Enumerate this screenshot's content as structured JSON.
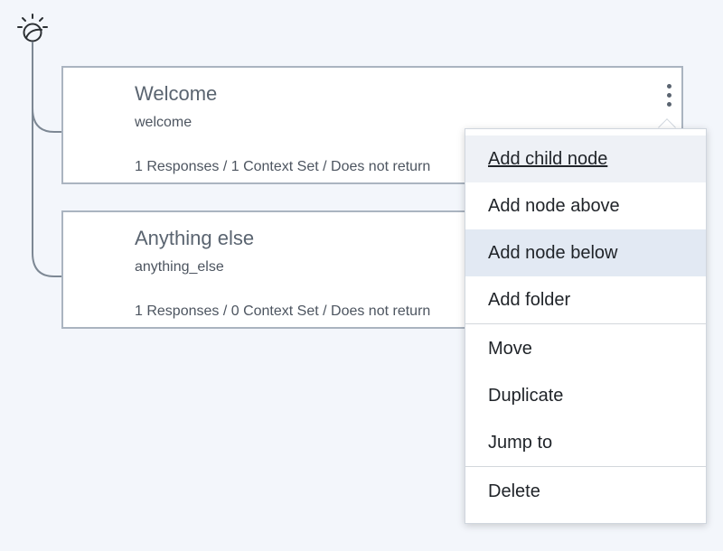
{
  "icons": {
    "tree_root": "bulb-icon",
    "overflow": "overflow-menu-icon"
  },
  "colors": {
    "background": "#f3f6fb",
    "card_border": "#aab4c0",
    "menu_hover": "#e2e9f3"
  },
  "nodes": [
    {
      "title": "Welcome",
      "condition": "welcome",
      "summary": "1 Responses / 1 Context Set / Does not return"
    },
    {
      "title": "Anything else",
      "condition": "anything_else",
      "summary": "1 Responses / 0 Context Set / Does not return"
    }
  ],
  "context_menu": {
    "groups": [
      [
        "Add child node",
        "Add node above",
        "Add node below",
        "Add folder"
      ],
      [
        "Move",
        "Duplicate",
        "Jump to"
      ],
      [
        "Delete"
      ]
    ],
    "focused_item": "Add child node",
    "hover_item": "Add node below"
  }
}
